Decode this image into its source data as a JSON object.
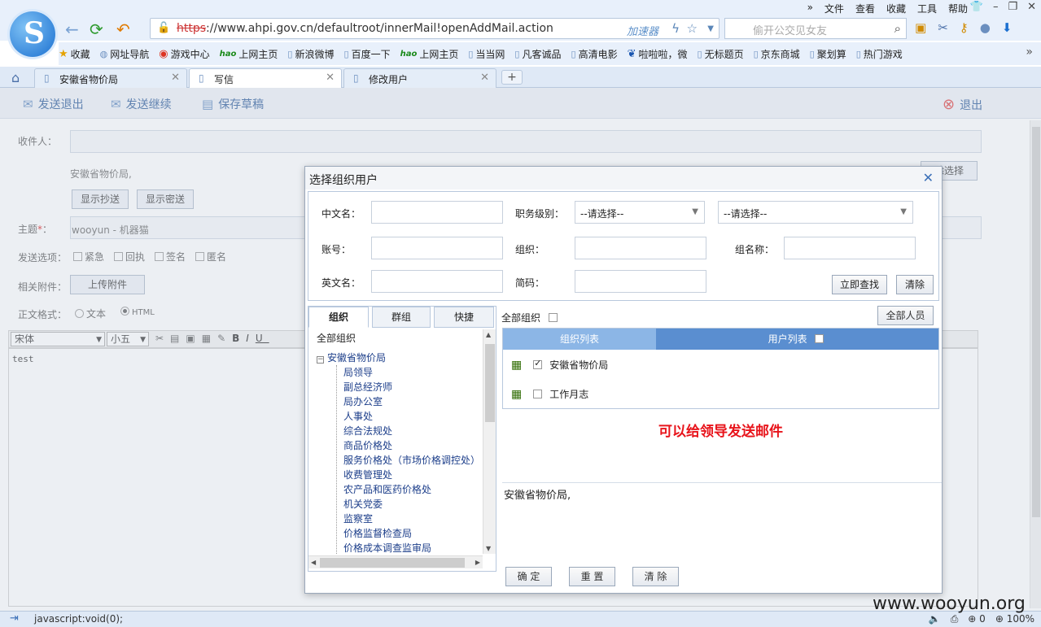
{
  "browser": {
    "menu": [
      "文件",
      "查看",
      "收藏",
      "工具",
      "帮助"
    ],
    "url_scheme": "https",
    "url_rest": "://www.ahpi.gov.cn/defaultroot/innerMail!openAddMail.action",
    "accelerator": "加速器",
    "search_placeholder": "偷开公交见女友",
    "bookmarks": [
      {
        "label": "收藏",
        "icon": "star-icon"
      },
      {
        "label": "网址导航",
        "icon": "globe-icon"
      },
      {
        "label": "游戏中心",
        "icon": "game-icon"
      },
      {
        "label": "上网主页",
        "icon": "hao-icon"
      },
      {
        "label": "新浪微博",
        "icon": "page-icon"
      },
      {
        "label": "百度一下",
        "icon": "page-icon"
      },
      {
        "label": "上网主页",
        "icon": "hao-icon"
      },
      {
        "label": "当当网",
        "icon": "page-icon"
      },
      {
        "label": "凡客诚品",
        "icon": "page-icon"
      },
      {
        "label": "高清电影",
        "icon": "page-icon"
      },
      {
        "label": "啦啦啦，微",
        "icon": "paw-icon"
      },
      {
        "label": "无标题页",
        "icon": "page-icon"
      },
      {
        "label": "京东商城",
        "icon": "page-icon"
      },
      {
        "label": "聚划算",
        "icon": "page-icon"
      },
      {
        "label": "热门游戏",
        "icon": "page-icon"
      }
    ],
    "tabs": [
      {
        "label": "安徽省物价局",
        "active": false
      },
      {
        "label": "写信",
        "active": true
      },
      {
        "label": "修改用户",
        "active": false
      }
    ],
    "status_text": "javascript:void(0);",
    "zoom": "100%",
    "status_count": "0"
  },
  "page": {
    "toolbar": {
      "send_exit": "发送退出",
      "send_continue": "发送继续",
      "save_draft": "保存草稿",
      "exit": "退出"
    },
    "form": {
      "recipient_label": "收件人：",
      "recipient_value": "安徽省物价局,",
      "show_cc": "显示抄送",
      "show_bcc": "显示密送",
      "clear_select": "除选择",
      "subject_label": "主题",
      "required_mark": "*",
      "subject_value": "wooyun - 机器猫",
      "send_options_label": "发送选项：",
      "options": [
        "紧急",
        "回执",
        "签名",
        "匿名"
      ],
      "attachment_label": "相关附件：",
      "upload_button": "上传附件",
      "format_label": "正文格式：",
      "format_text": "文本",
      "format_html": "HTML",
      "font_name": "宋体",
      "font_size": "小五",
      "body_text": "test"
    }
  },
  "dialog": {
    "title": "选择组织用户",
    "cn_name_label": "中文名：",
    "rank_label": "职务级别：",
    "rank_select_1": "--请选择--",
    "rank_select_2": "--请选择--",
    "account_label": "账号：",
    "org_label": "组织：",
    "group_name_label": "组名称：",
    "en_name_label": "英文名：",
    "short_code_label": "简码：",
    "search_button": "立即查找",
    "clear_button": "清除",
    "left_tabs": [
      "组织",
      "群组",
      "快捷"
    ],
    "tree_root": "全部组织",
    "tree_org": "安徽省物价局",
    "tree_children": [
      "局领导",
      "副总经济师",
      "局办公室",
      "人事处",
      "综合法规处",
      "商品价格处",
      "服务价格处（市场价格调控处）",
      "收费管理处",
      "农产品和医药价格处",
      "机关党委",
      "监察室",
      "价格监督检查局",
      "价格成本调查监审局"
    ],
    "all_org_label": "全部组织",
    "all_people_button": "全部人员",
    "grid_header_org": "组织列表",
    "grid_header_user": "用户列表",
    "grid_rows": [
      {
        "label": "安徽省物价局",
        "checked": true
      },
      {
        "label": "工作月志",
        "checked": false
      }
    ],
    "notice": "可以给领导发送邮件",
    "selected_text": "安徽省物价局,",
    "confirm_button": "确  定",
    "reset_button": "重  置",
    "clear_all_button": "清  除"
  },
  "watermark": "www.wooyun.org",
  "colors": {
    "chrome": "#e8f0fb",
    "grid_header": "#5a8ed0",
    "notice": "#e8141b",
    "link": "#1c3e8a"
  }
}
